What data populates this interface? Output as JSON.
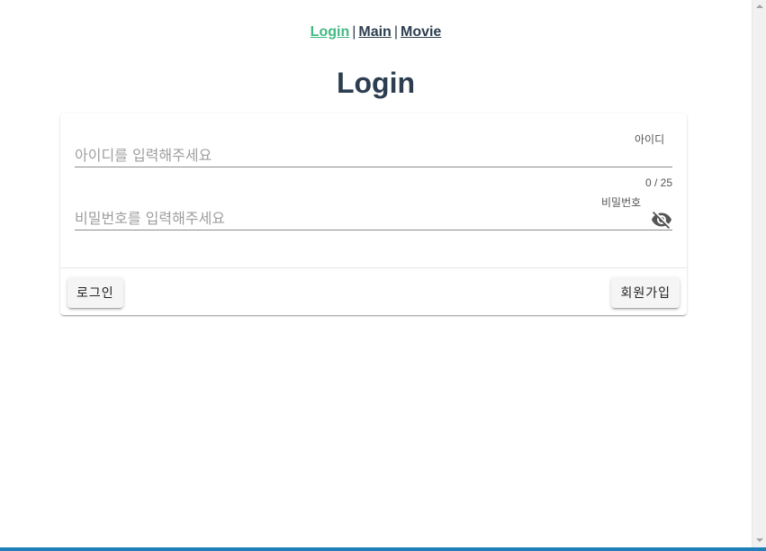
{
  "nav": {
    "links": [
      {
        "label": "Login",
        "active": true
      },
      {
        "label": "Main",
        "active": false
      },
      {
        "label": "Movie",
        "active": false
      }
    ],
    "separator": "|"
  },
  "page": {
    "title": "Login"
  },
  "form": {
    "id_field": {
      "label": "아이디",
      "placeholder": "아이디를 입력해주세요",
      "value": "",
      "counter": "0 / 25"
    },
    "password_field": {
      "label": "비밀번호",
      "placeholder": "비밀번호를 입력해주세요",
      "value": "",
      "toggle_icon": "eye-off-icon"
    }
  },
  "actions": {
    "login_label": "로그인",
    "signup_label": "회원가입"
  },
  "colors": {
    "accent": "#42b983",
    "text": "#2c3e50"
  }
}
